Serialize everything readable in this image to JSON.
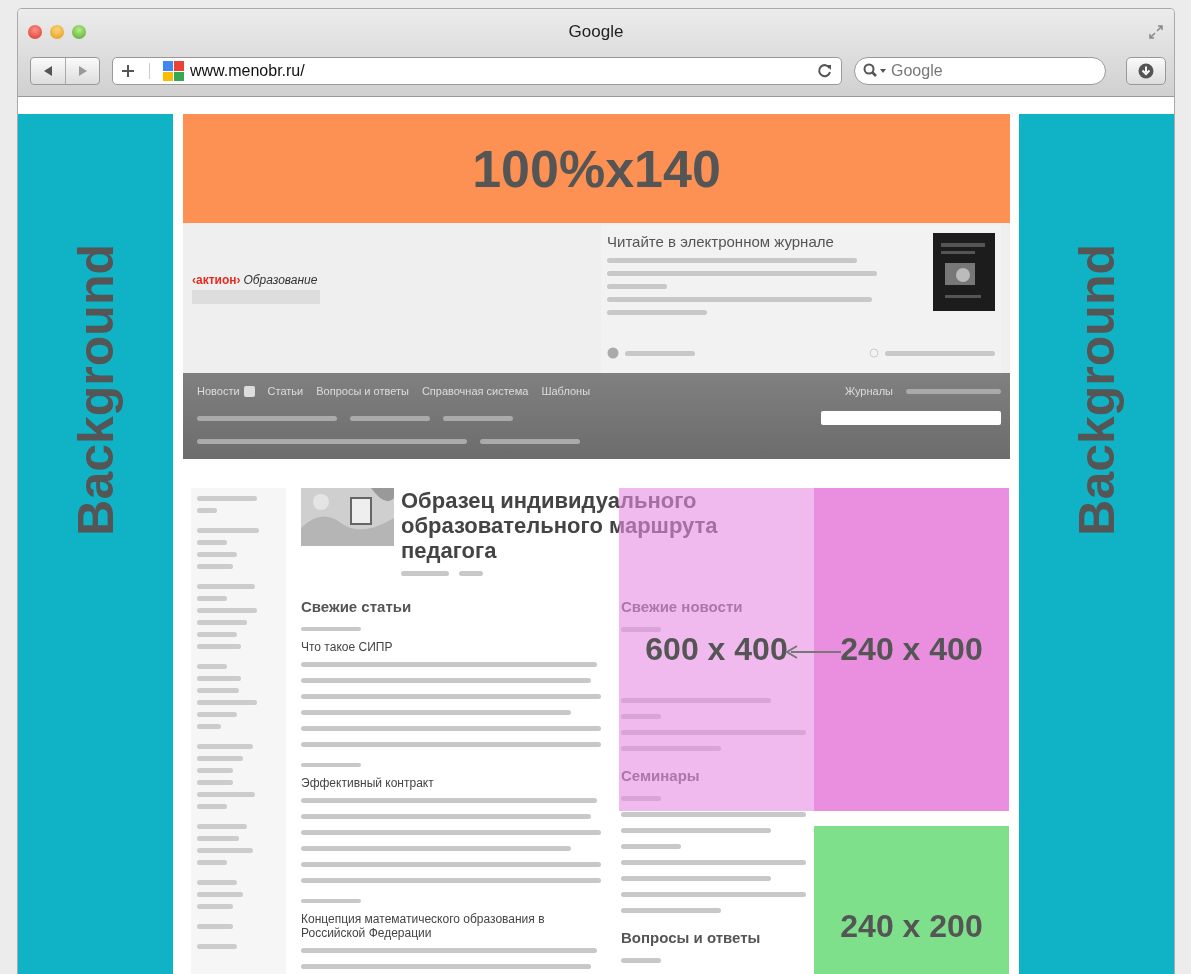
{
  "window": {
    "title": "Google"
  },
  "toolbar": {
    "url": "www.menobr.ru/",
    "search_placeholder": "Google"
  },
  "page": {
    "logo": {
      "brand": "‹актион›",
      "name": "Образование"
    },
    "promo": {
      "title": "Читайте в электронном журнале"
    },
    "nav": {
      "items": [
        "Новости",
        "Статьи",
        "Вопросы и ответы",
        "Справочная система",
        "Шаблоны"
      ],
      "right_items": [
        "Журналы"
      ]
    },
    "article": {
      "title": "Образец индивидуального образовательного маршрута педагога"
    },
    "fresh_articles": {
      "heading": "Свежие статьи",
      "items": [
        {
          "title": "Что такое СИПР"
        },
        {
          "title": "Эффективный контракт"
        },
        {
          "title": "Концепция математического образования в Российской Федерации"
        }
      ]
    },
    "side_sections": [
      {
        "heading": "Свежие новости"
      },
      {
        "heading": "Семинары"
      },
      {
        "heading": "Вопросы и ответы"
      }
    ]
  },
  "overlays": {
    "banner": "100%x140",
    "backgrounds": [
      "Background",
      "Background"
    ],
    "ads": [
      {
        "label": "600 x 400"
      },
      {
        "label": "240 x 400"
      },
      {
        "label": "240 x 200"
      }
    ]
  }
}
